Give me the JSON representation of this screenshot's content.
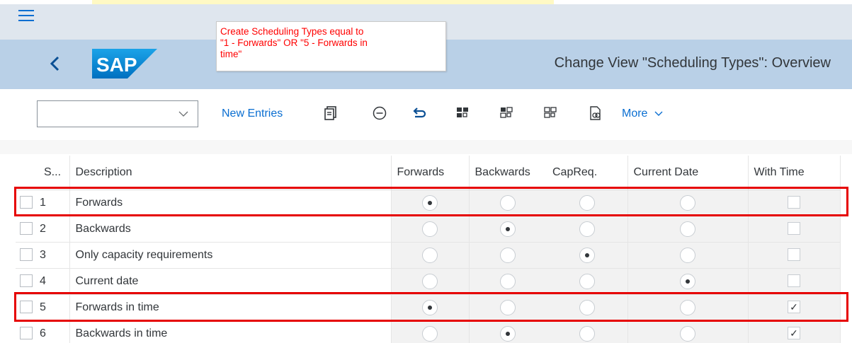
{
  "header": {
    "title": "Change View \"Scheduling Types\": Overview",
    "logo_text": "SAP"
  },
  "annotation": {
    "line1": "Create Scheduling Types equal to",
    "line2": "\"1 - Forwards\" OR \"5 - Forwards in",
    "line3": "time\""
  },
  "toolbar": {
    "dropdown_value": "",
    "new_entries_label": "New Entries",
    "more_label": "More"
  },
  "table": {
    "columns": [
      "S...",
      "Description",
      "Forwards",
      "Backwards",
      "CapReq.",
      "Current Date",
      "With Time"
    ],
    "rows": [
      {
        "num": "1",
        "desc": "Forwards",
        "selected_radio": "Forwards",
        "with_time": false
      },
      {
        "num": "2",
        "desc": "Backwards",
        "selected_radio": "Backwards",
        "with_time": false
      },
      {
        "num": "3",
        "desc": "Only capacity requirements",
        "selected_radio": "CapReq.",
        "with_time": false
      },
      {
        "num": "4",
        "desc": "Current date",
        "selected_radio": "Current Date",
        "with_time": false
      },
      {
        "num": "5",
        "desc": "Forwards in time",
        "selected_radio": "Forwards",
        "with_time": true
      },
      {
        "num": "6",
        "desc": "Backwards in time",
        "selected_radio": "Backwards",
        "with_time": true
      }
    ]
  },
  "colors": {
    "accent": "#0a6ed1",
    "shell": "#b9d0e7",
    "highlight": "#e60000",
    "annotation_text": "#ff0000"
  }
}
